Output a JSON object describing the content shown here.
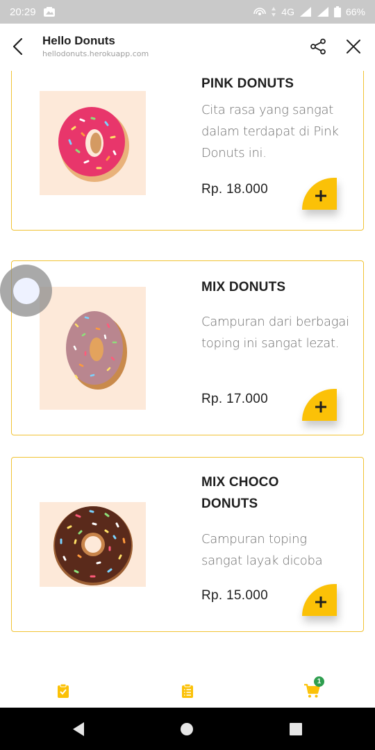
{
  "status_bar": {
    "time": "20:29",
    "network": "4G",
    "battery": "66%"
  },
  "header": {
    "title": "Hello Donuts",
    "url": "hellodonuts.herokuapp.com"
  },
  "products": [
    {
      "name": "PINK DONUTS",
      "description": "Cita rasa yang sangat dalam terdapat di Pink Donuts ini.",
      "price": "Rp. 18.000",
      "image_icon": "pink-donut"
    },
    {
      "name": "MIX DONUTS",
      "description": "Campuran dari berbagai toping ini sangat lezat.",
      "price": "Rp. 17.000",
      "image_icon": "mix-donut"
    },
    {
      "name": "MIX CHOCO DONUTS",
      "description": "Campuran toping sangat layak dicoba",
      "price": "Rp. 15.000",
      "image_icon": "choco-donut"
    }
  ],
  "bottom_nav": {
    "items": [
      {
        "icon": "clipboard-check-icon"
      },
      {
        "icon": "clipboard-list-icon"
      },
      {
        "icon": "cart-icon",
        "badge": "1"
      }
    ]
  },
  "colors": {
    "accent": "#fbc107",
    "card_border": "#f1c232",
    "image_bg": "#fde9d9",
    "badge": "#2e9e4f"
  }
}
